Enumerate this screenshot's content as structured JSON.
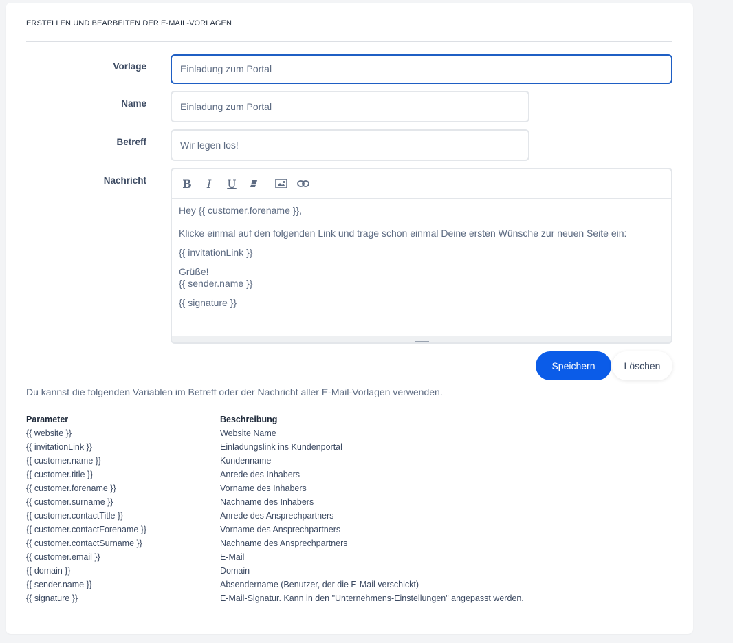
{
  "card": {
    "title": "ERSTELLEN UND BEARBEITEN DER E-MAIL-VORLAGEN"
  },
  "form": {
    "template_label": "Vorlage",
    "template_value": "Einladung zum Portal",
    "name_label": "Name",
    "name_value": "Einladung zum Portal",
    "subject_label": "Betreff",
    "subject_value": "Wir legen los!",
    "message_label": "Nachricht"
  },
  "editor": {
    "toolbar": {
      "bold": "B",
      "italic": "I",
      "underline": "U",
      "icons": [
        "bold-icon",
        "italic-icon",
        "underline-icon",
        "eraser-icon",
        "image-icon",
        "link-icon"
      ]
    },
    "lines": {
      "greeting": "Hey {{ customer.forename }},",
      "body": "Klicke einmal auf den folgenden Link und trage schon einmal Deine ersten Wünsche zur neuen Seite ein:",
      "link": "{{ invitationLink }}",
      "regards": "Grüße!",
      "sender": "{{ sender.name }}",
      "signature": "{{ signature }}"
    }
  },
  "buttons": {
    "save": "Speichern",
    "delete": "Löschen"
  },
  "variables": {
    "hint": "Du kannst die folgenden Variablen im Betreff oder der Nachricht aller E-Mail-Vorlagen verwenden.",
    "headers": {
      "param": "Parameter",
      "desc": "Beschreibung"
    },
    "rows": [
      [
        "{{ website }}",
        "Website Name"
      ],
      [
        "{{ invitationLink }}",
        "Einladungslink ins Kundenportal"
      ],
      [
        "{{ customer.name }}",
        "Kundenname"
      ],
      [
        "{{ customer.title }}",
        "Anrede des Inhabers"
      ],
      [
        "{{ customer.forename }}",
        "Vorname des Inhabers"
      ],
      [
        "{{ customer.surname }}",
        "Nachname des Inhabers"
      ],
      [
        "{{ customer.contactTitle }}",
        "Anrede des Ansprechpartners"
      ],
      [
        "{{ customer.contactForename }}",
        "Vorname des Ansprechpartners"
      ],
      [
        "{{ customer.contactSurname }}",
        "Nachname des Ansprechpartners"
      ],
      [
        "{{ customer.email }}",
        "E-Mail"
      ],
      [
        "{{ domain }}",
        "Domain"
      ],
      [
        "{{ sender.name }}",
        "Absendername (Benutzer, der die E-Mail verschickt)"
      ],
      [
        "{{ signature }}",
        "E-Mail-Signatur. Kann in den \"Unternehmens-Einstellungen\" angepasst werden."
      ]
    ]
  },
  "colors": {
    "accent": "#0b5ce8",
    "focus_border": "#1f5fc4",
    "text": "#5d6b82",
    "label": "#3c4a62"
  }
}
